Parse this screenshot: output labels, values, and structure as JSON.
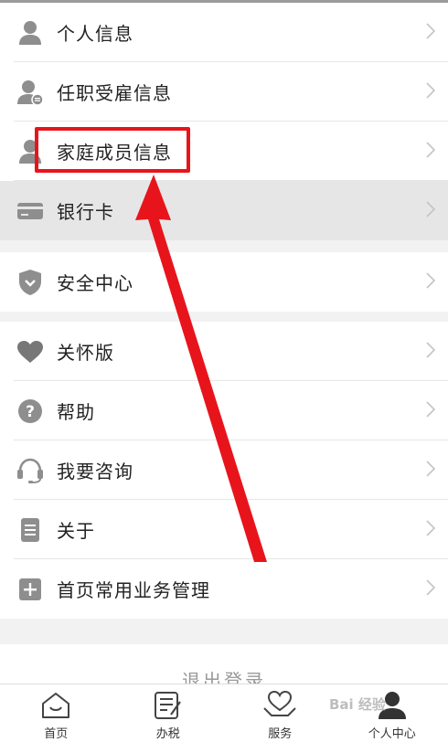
{
  "menu_group_1": [
    {
      "label": "个人信息",
      "icon": "person-icon"
    },
    {
      "label": "任职受雇信息",
      "icon": "person-employment-icon"
    },
    {
      "label": "家庭成员信息",
      "icon": "person-icon"
    },
    {
      "label": "银行卡",
      "icon": "bank-card-icon"
    }
  ],
  "menu_group_2": [
    {
      "label": "安全中心",
      "icon": "shield-icon"
    }
  ],
  "menu_group_3": [
    {
      "label": "关怀版",
      "icon": "heart-icon"
    },
    {
      "label": "帮助",
      "icon": "question-icon"
    },
    {
      "label": "我要咨询",
      "icon": "headset-icon"
    },
    {
      "label": "关于",
      "icon": "document-icon"
    },
    {
      "label": "首页常用业务管理",
      "icon": "plus-square-icon"
    }
  ],
  "logout_label": "退出登录",
  "tabs": [
    {
      "label": "首页",
      "icon": "home-icon"
    },
    {
      "label": "办税",
      "icon": "tax-form-icon"
    },
    {
      "label": "服务",
      "icon": "service-heart-icon"
    },
    {
      "label": "个人中心",
      "icon": "user-center-icon"
    }
  ],
  "watermark": "Bai 经验",
  "colors": {
    "annotation": "#e8141c",
    "icon_gray": "#8e8e8e",
    "highlight_row": "#e6e6e6"
  }
}
